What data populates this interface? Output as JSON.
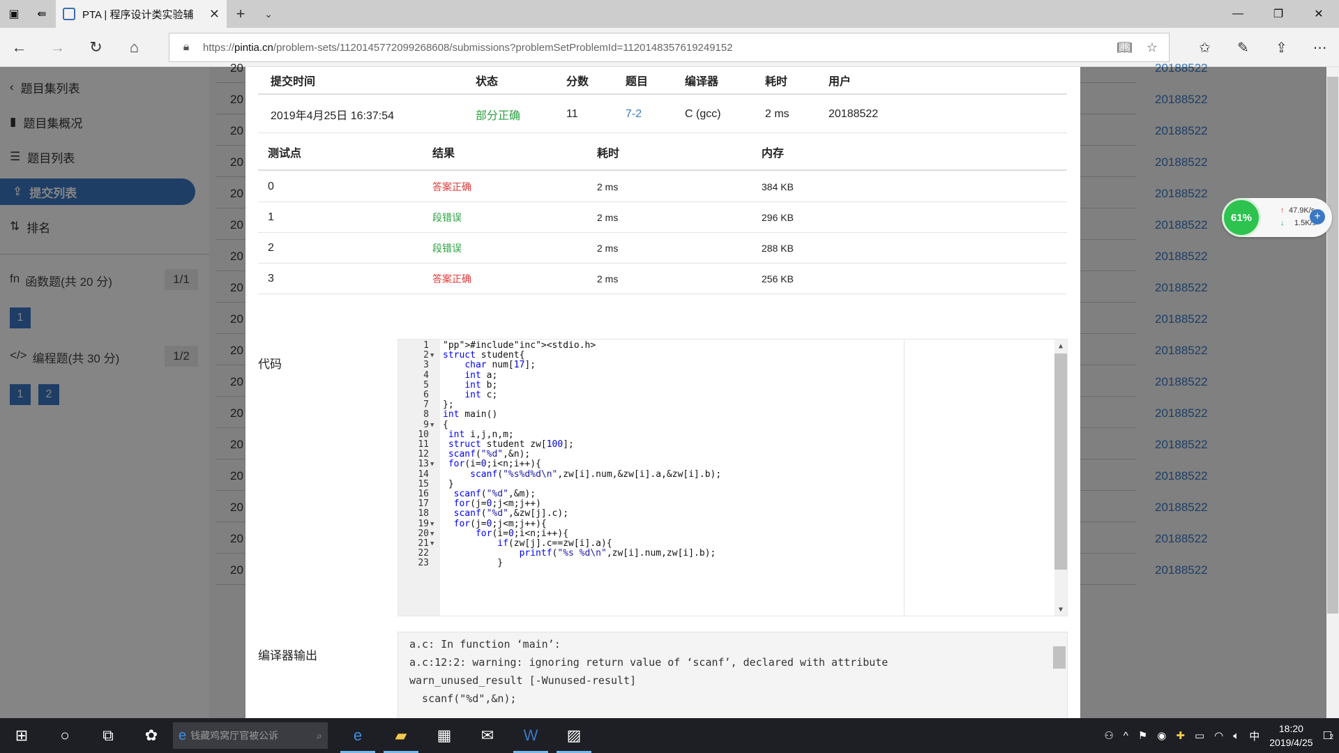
{
  "browser": {
    "tab_title": "PTA | 程序设计类实验辅",
    "url_prefix": "https://",
    "url_domain": "pintia.cn",
    "url_path": "/problem-sets/1120145772099268608/submissions?problemSetProblemId=1120148357619249152"
  },
  "sidebar": {
    "items": [
      {
        "label": "题目集列表"
      },
      {
        "label": "题目集概况"
      },
      {
        "label": "题目列表"
      },
      {
        "label": "提交列表"
      },
      {
        "label": "排名"
      }
    ],
    "sections": [
      {
        "icon_text": "fn",
        "label": "函数题(共 20 分)",
        "count": "1/1",
        "problems": [
          "1"
        ]
      },
      {
        "icon_text": "</>",
        "label": "编程题(共 30 分)",
        "count": "1/2",
        "problems": [
          "1",
          "2"
        ]
      }
    ]
  },
  "background": {
    "row_prefix": "20",
    "user": "20188522",
    "row_count": 17
  },
  "submission": {
    "headers": [
      "提交时间",
      "状态",
      "分数",
      "题目",
      "编译器",
      "耗时",
      "用户"
    ],
    "row": {
      "time": "2019年4月25日 16:37:54",
      "status": "部分正确",
      "score": "11",
      "problem": "7-2",
      "compiler": "C (gcc)",
      "duration": "2 ms",
      "user": "20188522"
    }
  },
  "testcases": {
    "headers": [
      "测试点",
      "结果",
      "耗时",
      "内存"
    ],
    "rows": [
      {
        "id": "0",
        "result": "答案正确",
        "time": "2 ms",
        "memory": "384 KB"
      },
      {
        "id": "1",
        "result": "段错误",
        "time": "2 ms",
        "memory": "296 KB"
      },
      {
        "id": "2",
        "result": "段错误",
        "time": "2 ms",
        "memory": "288 KB"
      },
      {
        "id": "3",
        "result": "答案正确",
        "time": "2 ms",
        "memory": "256 KB"
      }
    ]
  },
  "code_label": "代码",
  "code_lines": [
    "#include<stdio.h>",
    "struct student{",
    "    char num[17];",
    "    int a;",
    "    int b;",
    "    int c;",
    "};",
    "int main()",
    "{",
    " int i,j,n,m;",
    " struct student zw[100];",
    " scanf(\"%d\",&n);",
    " for(i=0;i<n;i++){",
    "     scanf(\"%s%d%d\\n\",zw[i].num,&zw[i].a,&zw[i].b);",
    " }",
    "  scanf(\"%d\",&m);",
    "  for(j=0;j<m;j++)",
    "  scanf(\"%d\",&zw[j].c);",
    "  for(j=0;j<m;j++){",
    "      for(i=0;i<n;i++){",
    "          if(zw[j].c==zw[i].a){",
    "              printf(\"%s %d\\n\",zw[i].num,zw[i].b);",
    "          }"
  ],
  "output_label": "编译器输出",
  "compiler_output": [
    "a.c: In function ‘main’:",
    "a.c:12:2: warning: ignoring return value of ‘scanf’, declared with attribute",
    "warn_unused_result [-Wunused-result]",
    "  scanf(\"%d\",&n);"
  ],
  "net_widget": {
    "percent": "61%",
    "up": "47.9K/s",
    "down": "1.5K/s"
  },
  "taskbar": {
    "search_placeholder": "钱藏鸡窝厅官被公诉",
    "time": "18:20",
    "date": "2019/4/25",
    "ime": "中",
    "notifications": "2"
  },
  "colors": {
    "accent": "#3a78c3",
    "success": "#2aa141",
    "error": "#e03a3a"
  }
}
